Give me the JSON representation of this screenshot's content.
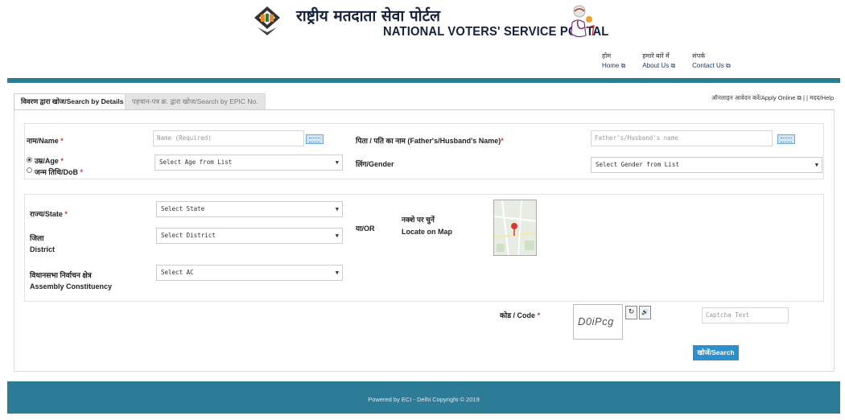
{
  "header": {
    "title_hindi": "राष्ट्रीय मतदाता सेवा पोर्टल",
    "title_english": "NATIONAL VOTERS' SERVICE PORTAL",
    "links": [
      {
        "hindi": "होम",
        "label": "Home"
      },
      {
        "hindi": "हमारे बारे में",
        "label": "About Us"
      },
      {
        "hindi": "संपर्क",
        "label": "Contact Us"
      }
    ]
  },
  "tabs": [
    {
      "label": "विवरण द्वारा खोज/Search by Details",
      "active": true
    },
    {
      "label": "पहचान-पत्र क्र. द्वारा खोज/Search by EPIC No.",
      "active": false
    }
  ],
  "right_links": {
    "apply_online": "ऑनलाइन आवेदन करें/Apply Online",
    "separator": "|",
    "help": "मदद/Help"
  },
  "form": {
    "name_label": "नाम/Name",
    "name_placeholder": "Name (Required)",
    "father_label": "पिता / पति का नाम (Father's/Husband's Name)",
    "father_placeholder": "Father's/Husband's name",
    "age_label": "उम्र/Age",
    "dob_label": "जन्म तिथि/DoB",
    "age_select": "Select Age from List",
    "gender_label": "लिंग/Gender",
    "gender_select": "Select Gender from List",
    "state_label": "राज्य/State",
    "state_select": "Select State",
    "district_label_hindi": "जिला",
    "district_label": "District",
    "district_select": "Select District",
    "ac_label_hindi": "विधानसभा निर्वाचन क्षेत्र",
    "ac_label": "Assembly Constituency",
    "ac_select": "Select AC",
    "or_label": "या/OR",
    "map_label_hindi": "नक्शे पर चुनें",
    "map_label": "Locate on Map",
    "code_label": "कोड / Code",
    "captcha_text": "D0iPcg",
    "captcha_placeholder": "Captcha Text",
    "refresh_icon": "↻",
    "audio_icon": "🔊",
    "search_button": "खोजें/Search",
    "required_mark": "*"
  },
  "footer": {
    "text": "Powered by ECI - Delhi Copyright © 2019"
  },
  "colors": {
    "bar": "#2d7c97",
    "button": "#2d8fcb",
    "title": "#14223f"
  }
}
